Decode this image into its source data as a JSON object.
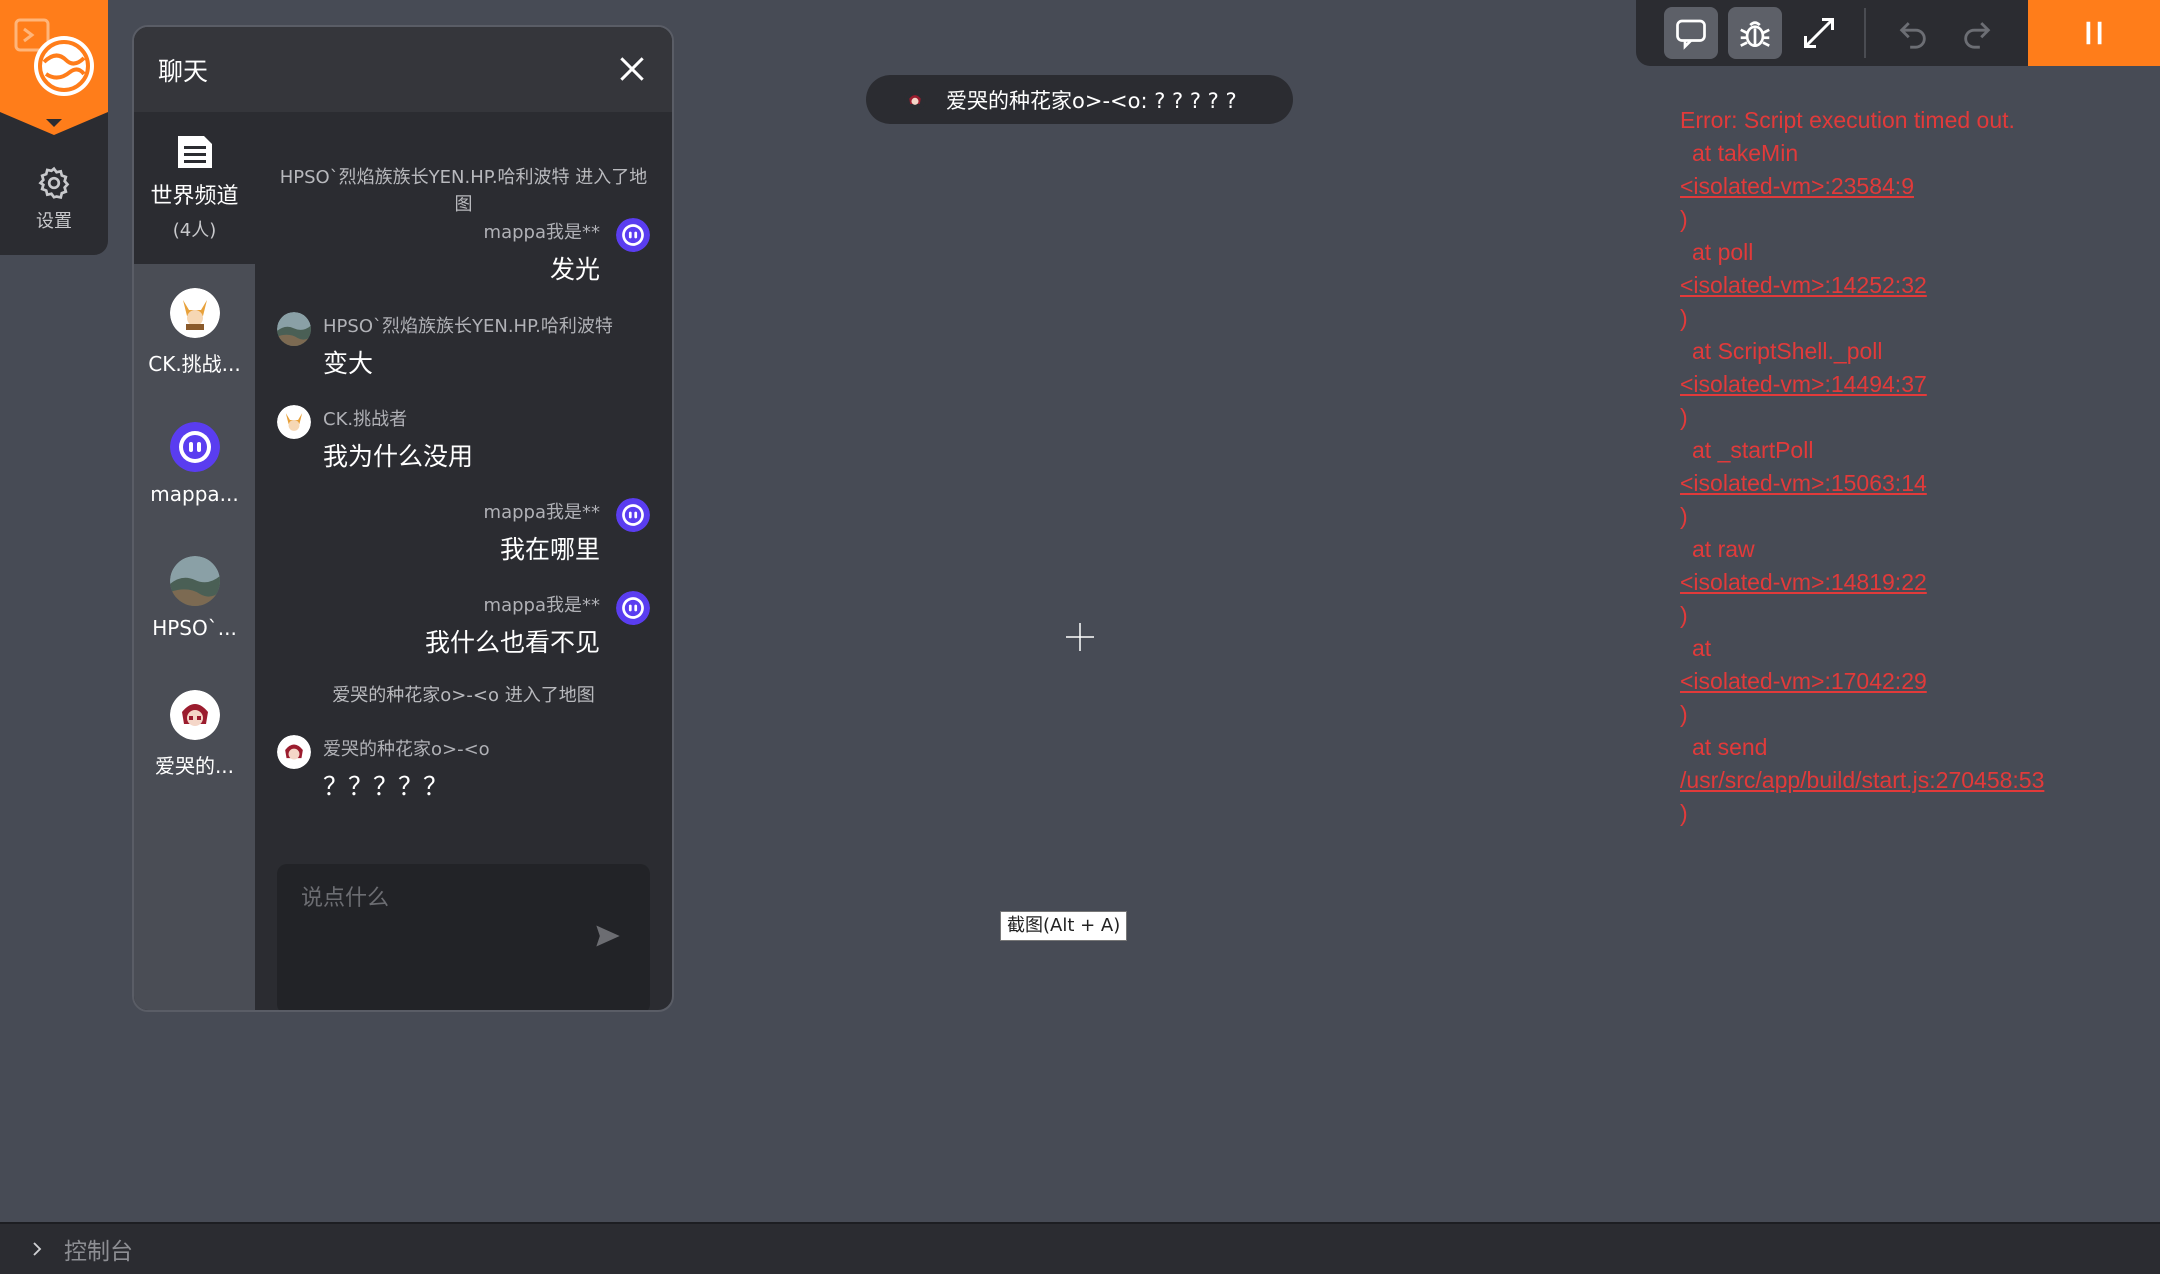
{
  "left_bar": {
    "settings_label": "设置"
  },
  "chat": {
    "title": "聊天",
    "world_channel": {
      "name": "世界频道",
      "count": "(4人)"
    },
    "contacts": [
      {
        "name": "CK.挑战..."
      },
      {
        "name": "mappa..."
      },
      {
        "name": "HPSO`..."
      },
      {
        "name": "爱哭的..."
      }
    ],
    "messages": [
      {
        "type": "system",
        "text": "HPSO`烈焰族族长YEN.HP.哈利波特 进入了地图"
      },
      {
        "type": "self",
        "sender": "mappa我是**",
        "text": "发光"
      },
      {
        "type": "other",
        "sender": "HPSO`烈焰族族长YEN.HP.哈利波特",
        "text": "变大"
      },
      {
        "type": "other",
        "sender": "CK.挑战者",
        "text": "我为什么没用"
      },
      {
        "type": "self",
        "sender": "mappa我是**",
        "text": "我在哪里"
      },
      {
        "type": "self",
        "sender": "mappa我是**",
        "text": "我什么也看不见"
      },
      {
        "type": "system",
        "text": "爱哭的种花家o>-<o 进入了地图"
      },
      {
        "type": "other",
        "sender": "爱哭的种花家o>-<o",
        "text": "？？？？？"
      }
    ],
    "input_placeholder": "说点什么"
  },
  "notice": {
    "text": "爱哭的种花家o>-<o: ? ? ? ? ?"
  },
  "error": {
    "title": "Error: Script execution timed out.",
    "frames": [
      {
        "at": "at takeMin",
        "loc": "<isolated-vm>:23584:9"
      },
      {
        "at": "at poll",
        "loc": "<isolated-vm>:14252:32"
      },
      {
        "at": "at ScriptShell._poll",
        "loc": "<isolated-vm>:14494:37"
      },
      {
        "at": "at _startPoll",
        "loc": "<isolated-vm>:15063:14"
      },
      {
        "at": "at raw",
        "loc": "<isolated-vm>:14819:22"
      },
      {
        "at": "at",
        "loc": "<isolated-vm>:17042:29"
      },
      {
        "at": "at send",
        "loc": "/usr/src/app/build/start.js:270458:53"
      }
    ]
  },
  "tooltip": {
    "text": "截图(Alt + A)"
  },
  "console": {
    "label": "控制台"
  },
  "colors": {
    "accent": "#ff7d1a",
    "error": "#e23a3a",
    "panel": "#2b2c31",
    "background": "#474b55"
  },
  "icons": {
    "toolbar": [
      "chat-icon",
      "bug-icon",
      "resize-icon",
      "undo-icon",
      "redo-icon",
      "pause-icon"
    ]
  }
}
